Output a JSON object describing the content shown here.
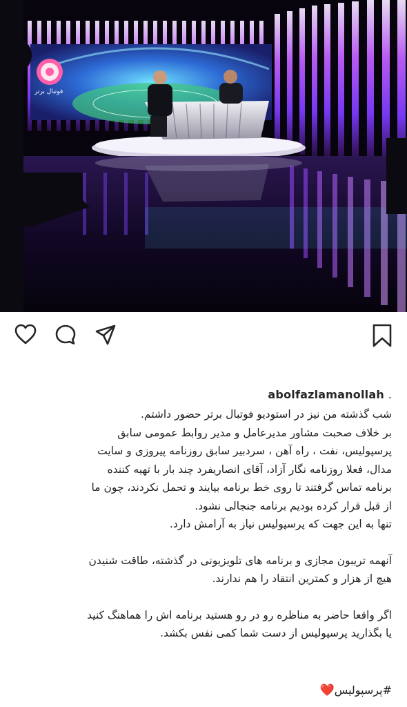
{
  "post": {
    "username": "abolfazlamanollah",
    "username_suffix": ".",
    "image_logo_text": "فوتبال برتر",
    "caption_lines_1": [
      "شب گذشته من نیز در استودیو فوتبال برتر حضور داشتم.",
      "بر خلاف صحبت مشاور مدیرعامل و مدیر روابط عمومی سابق",
      "پرسپولیس، نفت ، راه آهن ، سردبیر سابق روزنامه پیروزی و سایت",
      "مدال، فعلا روزنامه نگار آزاد، آقای انصاریفرد چند بار با تهیه کننده",
      "برنامه تماس گرفتند تا روی خط برنامه بیایند و تحمل نکردند، چون ما",
      "از قبل قرار کرده بودیم برنامه جنجالی نشود.",
      "تنها به این جهت که پرسپولیس نیاز به آرامش دارد."
    ],
    "caption_lines_2": [
      "آنهمه تریبون مجازی و برنامه های تلویزیونی در گذشته، طاقت شنیدن",
      "هیچ از هزار و کمترین انتقاد را هم ندارند."
    ],
    "caption_lines_3": [
      "اگر واقعا حاضر به مناظره رو در رو هستید برنامه اش را هماهنگ کنید",
      "یا بگذارید پرسپولیس از دست شما کمی نفس بکشد."
    ],
    "hashtag": "#پرسپولیس",
    "heart_emoji": "❤️"
  },
  "icons": {
    "like": "heart-outline-icon",
    "comment": "comment-bubble-icon",
    "share": "paper-plane-icon",
    "save": "bookmark-outline-icon"
  },
  "colors": {
    "text": "#262626",
    "heart_emoji": "#e0245e",
    "studio_purple": "#b452ff",
    "studio_cyan": "#4fd8ff"
  }
}
